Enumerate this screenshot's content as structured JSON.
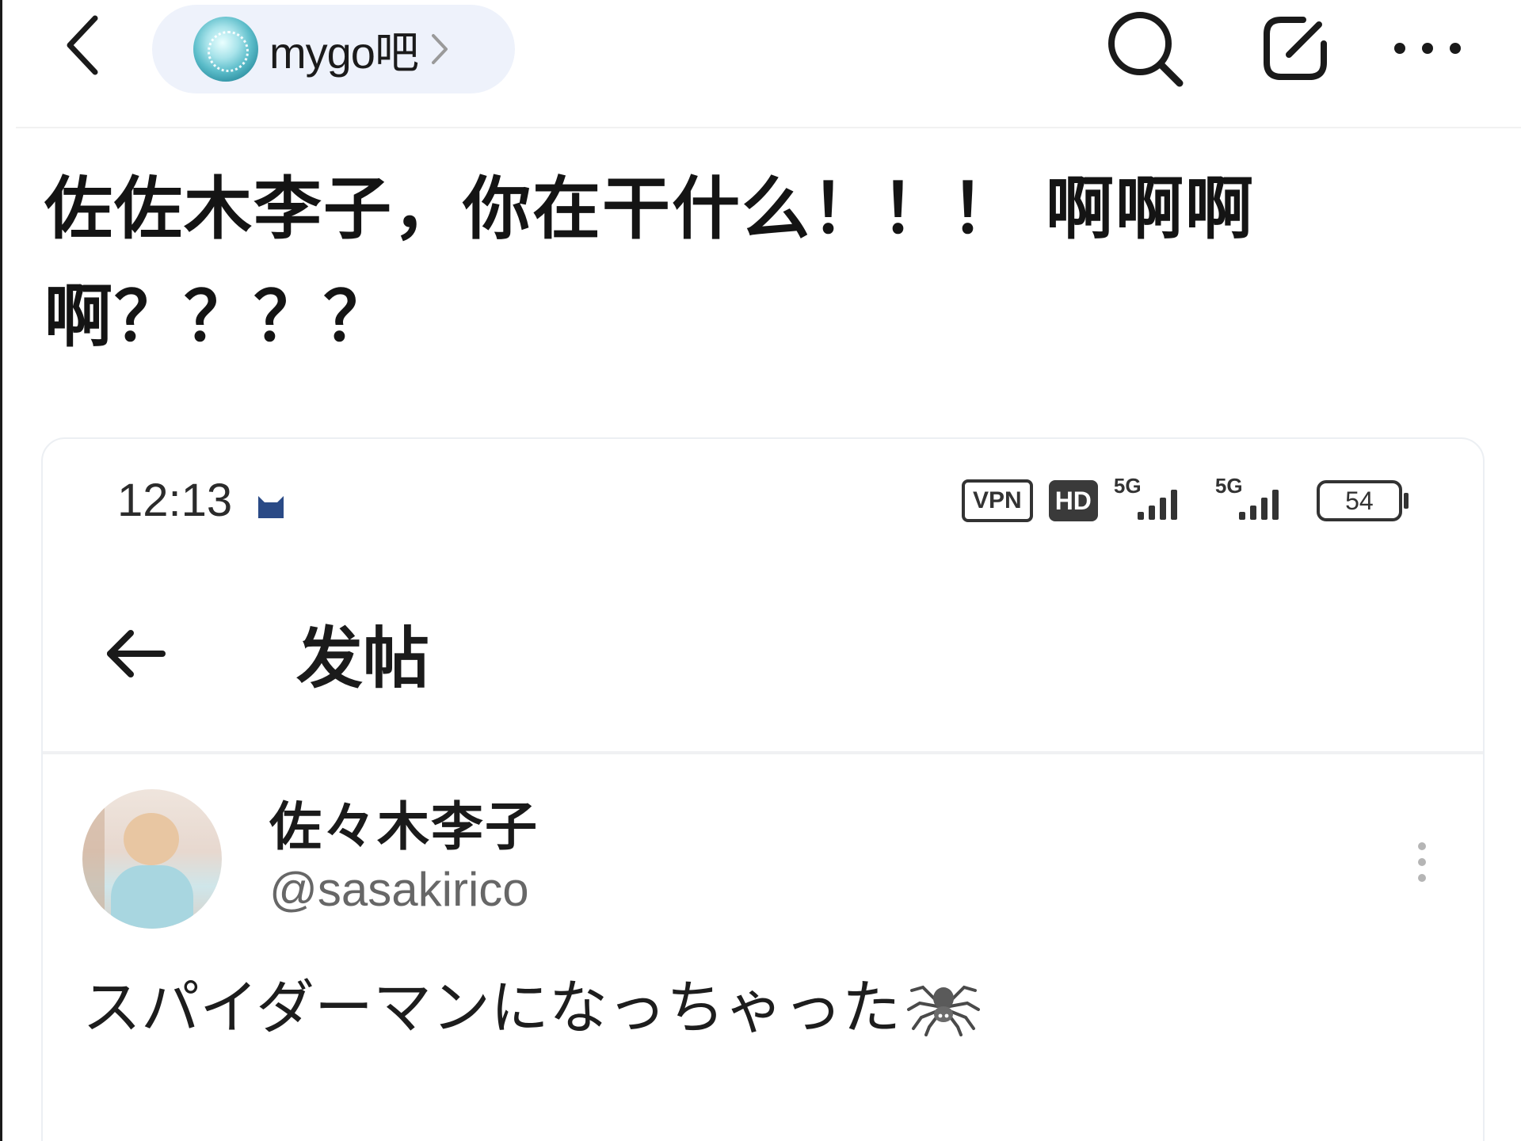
{
  "topbar": {
    "forum_name": "mygo吧",
    "icons": {
      "back": "chevron-left-icon",
      "search": "search-icon",
      "share": "share-icon",
      "more": "more-horizontal-icon"
    }
  },
  "post": {
    "title": "佐佐木李子，你在干什么！！！ 啊啊啊啊？？？？"
  },
  "embedded": {
    "status_bar": {
      "time": "12:13",
      "vpn": "VPN",
      "hd": "HD",
      "network_1": "5G",
      "network_2": "5G",
      "battery": "54"
    },
    "header": {
      "back_icon": "arrow-left-icon",
      "title": "发帖"
    },
    "tweet": {
      "author": "佐々木李子",
      "handle": "@sasakirico",
      "text": "スパイダーマンになっちゃった",
      "emoji": "spider-icon"
    }
  },
  "colors": {
    "chip_background": "#eef2fb",
    "text_primary": "#141414",
    "handle_grey": "#676767"
  }
}
